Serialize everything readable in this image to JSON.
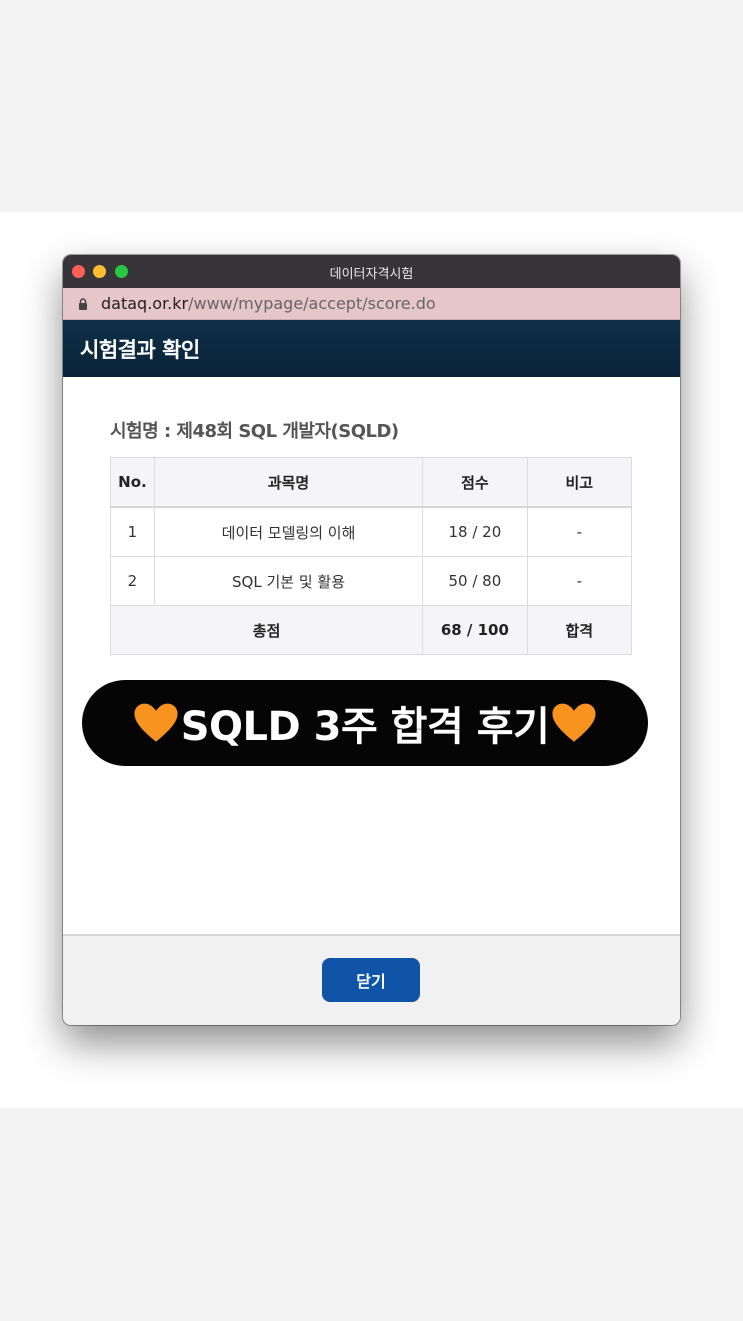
{
  "window": {
    "title": "데이터자격시험",
    "url_host": "dataq.or.kr",
    "url_path": "/www/mypage/accept/score.do"
  },
  "header": {
    "title": "시험결과 확인"
  },
  "exam": {
    "name": "시험명 : 제48회 SQL 개발자(SQLD)"
  },
  "table": {
    "columns": [
      "No.",
      "과목명",
      "점수",
      "비고"
    ],
    "rows": [
      {
        "no": "1",
        "subject": "데이터 모델링의 이해",
        "score": "18 / 20",
        "note": "-"
      },
      {
        "no": "2",
        "subject": "SQL 기본 및 활용",
        "score": "50 / 80",
        "note": "-"
      }
    ],
    "total": {
      "label": "총점",
      "score": "68 / 100",
      "result": "합격"
    }
  },
  "banner": {
    "text": "SQLD 3주 합격 후기",
    "icon": "orange-heart-icon",
    "color": "#f7931e"
  },
  "footer": {
    "close_label": "닫기"
  },
  "colors": {
    "header_bg": "#0e3049",
    "button_bg": "#1054a7",
    "urlbar_bg": "#e6c5cb"
  }
}
